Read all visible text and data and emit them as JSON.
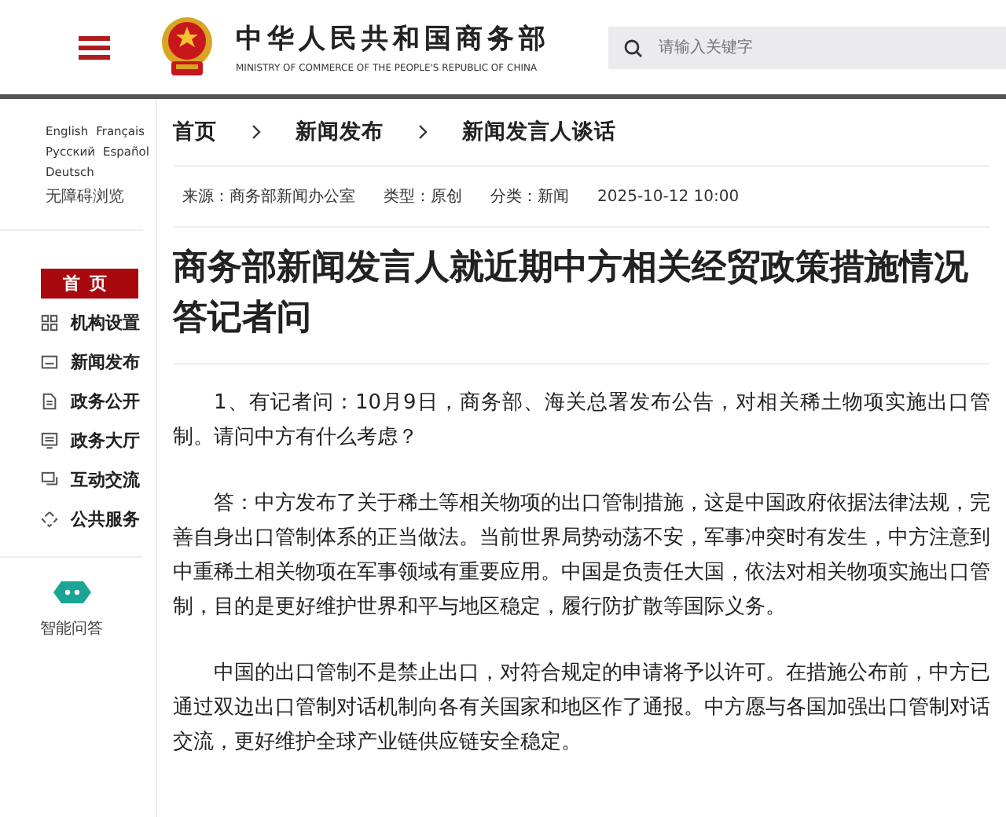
{
  "header": {
    "title": "中华人民共和国商务部",
    "subtitle": "MINISTRY OF COMMERCE OF THE PEOPLE'S REPUBLIC OF CHINA",
    "search": {
      "placeholder": "请输入关键字"
    }
  },
  "languages": [
    [
      "English",
      "Français"
    ],
    [
      "Русский",
      "Español"
    ],
    [
      "Deutsch"
    ],
    [
      "无障碍浏览"
    ]
  ],
  "nav": [
    {
      "label": "首页",
      "selected": true
    },
    {
      "label": "机构设置",
      "selected": false
    },
    {
      "label": "新闻发布",
      "selected": false
    },
    {
      "label": "政务公开",
      "selected": false
    },
    {
      "label": "政务大厅",
      "selected": false
    },
    {
      "label": "互动交流",
      "selected": false
    },
    {
      "label": "公共服务",
      "selected": false
    }
  ],
  "assistant": {
    "label": "智能问答"
  },
  "breadcrumb": [
    "首页",
    "新闻发布",
    "新闻发言人谈话"
  ],
  "meta": [
    "来源：商务部新闻办公室",
    "类型：原创",
    "分类：新闻",
    "2025-10-12 10:00"
  ],
  "title": "商务部新闻发言人就近期中方相关经贸政策措施情况答记者问",
  "paragraphs": [
    "1、有记者问：10月9日，商务部、海关总署发布公告，对相关稀土物项实施出口管制。请问中方有什么考虑？",
    "答：中方发布了关于稀土等相关物项的出口管制措施，这是中国政府依据法律法规，完善自身出口管制体系的正当做法。当前世界局势动荡不安，军事冲突时有发生，中方注意到中重稀土相关物项在军事领域有重要应用。中国是负责任大国，依法对相关物项实施出口管制，目的是更好维护世界和平与地区稳定，履行防扩散等国际义务。",
    "中国的出口管制不是禁止出口，对符合规定的申请将予以许可。在措施公布前，中方已通过双边出口管制对话机制向各有关国家和地区作了通报。中方愿与各国加强出口管制对话交流，更好维护全球产业链供应链安全稳定。"
  ]
}
